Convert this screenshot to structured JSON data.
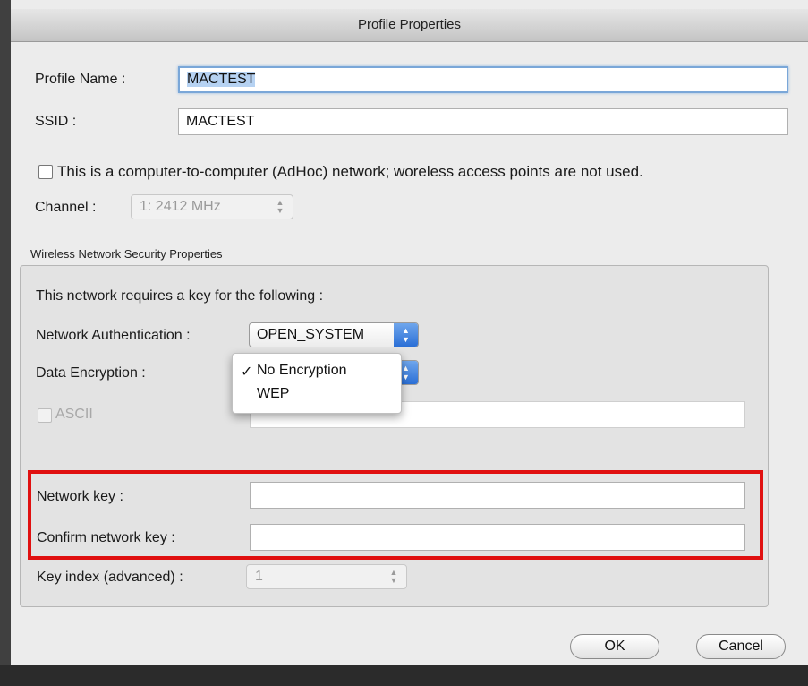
{
  "window": {
    "title": "Profile Properties"
  },
  "profile": {
    "name_label": "Profile Name :",
    "name_value": "MACTEST",
    "ssid_label": "SSID :",
    "ssid_value": "MACTEST",
    "adhoc_label": "This is a computer-to-computer (AdHoc) network; woreless access points are not used.",
    "adhoc_checked": false,
    "channel_label": "Channel :",
    "channel_value": "1: 2412 MHz"
  },
  "security": {
    "group_title": "Wireless Network Security Properties",
    "intro": "This network requires a key for the following :",
    "auth_label": "Network Authentication :",
    "auth_value": "OPEN_SYSTEM",
    "encryption_label": "Data Encryption :",
    "encryption_menu": [
      {
        "label": "No Encryption",
        "checked": true,
        "mark": "✓"
      },
      {
        "label": "WEP",
        "checked": false,
        "mark": ""
      }
    ],
    "ascii_label": "ASCII",
    "network_key_label": "Network key :",
    "network_key_value": "",
    "confirm_key_label": "Confirm network key :",
    "confirm_key_value": "",
    "key_index_label": "Key index (advanced) :",
    "key_index_value": "1"
  },
  "buttons": {
    "ok": "OK",
    "cancel": "Cancel"
  },
  "colors": {
    "highlight": "#e01010",
    "accent": "#2a6fd6"
  }
}
